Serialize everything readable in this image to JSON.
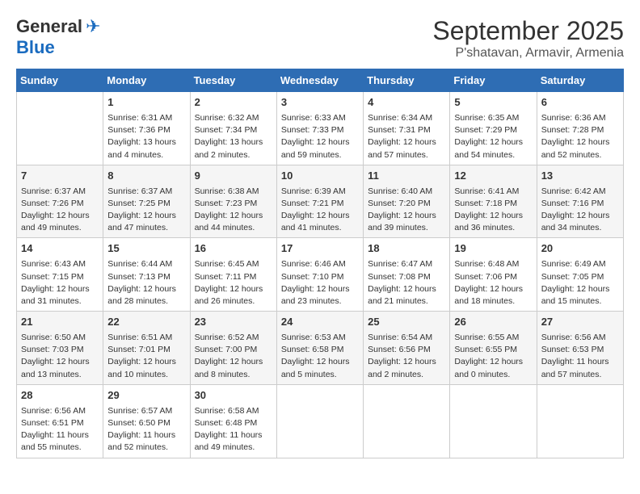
{
  "header": {
    "logo_general": "General",
    "logo_blue": "Blue",
    "month": "September 2025",
    "location": "P'shatavan, Armavir, Armenia"
  },
  "days_of_week": [
    "Sunday",
    "Monday",
    "Tuesday",
    "Wednesday",
    "Thursday",
    "Friday",
    "Saturday"
  ],
  "weeks": [
    [
      {
        "day": "",
        "info": ""
      },
      {
        "day": "1",
        "info": "Sunrise: 6:31 AM\nSunset: 7:36 PM\nDaylight: 13 hours\nand 4 minutes."
      },
      {
        "day": "2",
        "info": "Sunrise: 6:32 AM\nSunset: 7:34 PM\nDaylight: 13 hours\nand 2 minutes."
      },
      {
        "day": "3",
        "info": "Sunrise: 6:33 AM\nSunset: 7:33 PM\nDaylight: 12 hours\nand 59 minutes."
      },
      {
        "day": "4",
        "info": "Sunrise: 6:34 AM\nSunset: 7:31 PM\nDaylight: 12 hours\nand 57 minutes."
      },
      {
        "day": "5",
        "info": "Sunrise: 6:35 AM\nSunset: 7:29 PM\nDaylight: 12 hours\nand 54 minutes."
      },
      {
        "day": "6",
        "info": "Sunrise: 6:36 AM\nSunset: 7:28 PM\nDaylight: 12 hours\nand 52 minutes."
      }
    ],
    [
      {
        "day": "7",
        "info": "Sunrise: 6:37 AM\nSunset: 7:26 PM\nDaylight: 12 hours\nand 49 minutes."
      },
      {
        "day": "8",
        "info": "Sunrise: 6:37 AM\nSunset: 7:25 PM\nDaylight: 12 hours\nand 47 minutes."
      },
      {
        "day": "9",
        "info": "Sunrise: 6:38 AM\nSunset: 7:23 PM\nDaylight: 12 hours\nand 44 minutes."
      },
      {
        "day": "10",
        "info": "Sunrise: 6:39 AM\nSunset: 7:21 PM\nDaylight: 12 hours\nand 41 minutes."
      },
      {
        "day": "11",
        "info": "Sunrise: 6:40 AM\nSunset: 7:20 PM\nDaylight: 12 hours\nand 39 minutes."
      },
      {
        "day": "12",
        "info": "Sunrise: 6:41 AM\nSunset: 7:18 PM\nDaylight: 12 hours\nand 36 minutes."
      },
      {
        "day": "13",
        "info": "Sunrise: 6:42 AM\nSunset: 7:16 PM\nDaylight: 12 hours\nand 34 minutes."
      }
    ],
    [
      {
        "day": "14",
        "info": "Sunrise: 6:43 AM\nSunset: 7:15 PM\nDaylight: 12 hours\nand 31 minutes."
      },
      {
        "day": "15",
        "info": "Sunrise: 6:44 AM\nSunset: 7:13 PM\nDaylight: 12 hours\nand 28 minutes."
      },
      {
        "day": "16",
        "info": "Sunrise: 6:45 AM\nSunset: 7:11 PM\nDaylight: 12 hours\nand 26 minutes."
      },
      {
        "day": "17",
        "info": "Sunrise: 6:46 AM\nSunset: 7:10 PM\nDaylight: 12 hours\nand 23 minutes."
      },
      {
        "day": "18",
        "info": "Sunrise: 6:47 AM\nSunset: 7:08 PM\nDaylight: 12 hours\nand 21 minutes."
      },
      {
        "day": "19",
        "info": "Sunrise: 6:48 AM\nSunset: 7:06 PM\nDaylight: 12 hours\nand 18 minutes."
      },
      {
        "day": "20",
        "info": "Sunrise: 6:49 AM\nSunset: 7:05 PM\nDaylight: 12 hours\nand 15 minutes."
      }
    ],
    [
      {
        "day": "21",
        "info": "Sunrise: 6:50 AM\nSunset: 7:03 PM\nDaylight: 12 hours\nand 13 minutes."
      },
      {
        "day": "22",
        "info": "Sunrise: 6:51 AM\nSunset: 7:01 PM\nDaylight: 12 hours\nand 10 minutes."
      },
      {
        "day": "23",
        "info": "Sunrise: 6:52 AM\nSunset: 7:00 PM\nDaylight: 12 hours\nand 8 minutes."
      },
      {
        "day": "24",
        "info": "Sunrise: 6:53 AM\nSunset: 6:58 PM\nDaylight: 12 hours\nand 5 minutes."
      },
      {
        "day": "25",
        "info": "Sunrise: 6:54 AM\nSunset: 6:56 PM\nDaylight: 12 hours\nand 2 minutes."
      },
      {
        "day": "26",
        "info": "Sunrise: 6:55 AM\nSunset: 6:55 PM\nDaylight: 12 hours\nand 0 minutes."
      },
      {
        "day": "27",
        "info": "Sunrise: 6:56 AM\nSunset: 6:53 PM\nDaylight: 11 hours\nand 57 minutes."
      }
    ],
    [
      {
        "day": "28",
        "info": "Sunrise: 6:56 AM\nSunset: 6:51 PM\nDaylight: 11 hours\nand 55 minutes."
      },
      {
        "day": "29",
        "info": "Sunrise: 6:57 AM\nSunset: 6:50 PM\nDaylight: 11 hours\nand 52 minutes."
      },
      {
        "day": "30",
        "info": "Sunrise: 6:58 AM\nSunset: 6:48 PM\nDaylight: 11 hours\nand 49 minutes."
      },
      {
        "day": "",
        "info": ""
      },
      {
        "day": "",
        "info": ""
      },
      {
        "day": "",
        "info": ""
      },
      {
        "day": "",
        "info": ""
      }
    ]
  ]
}
